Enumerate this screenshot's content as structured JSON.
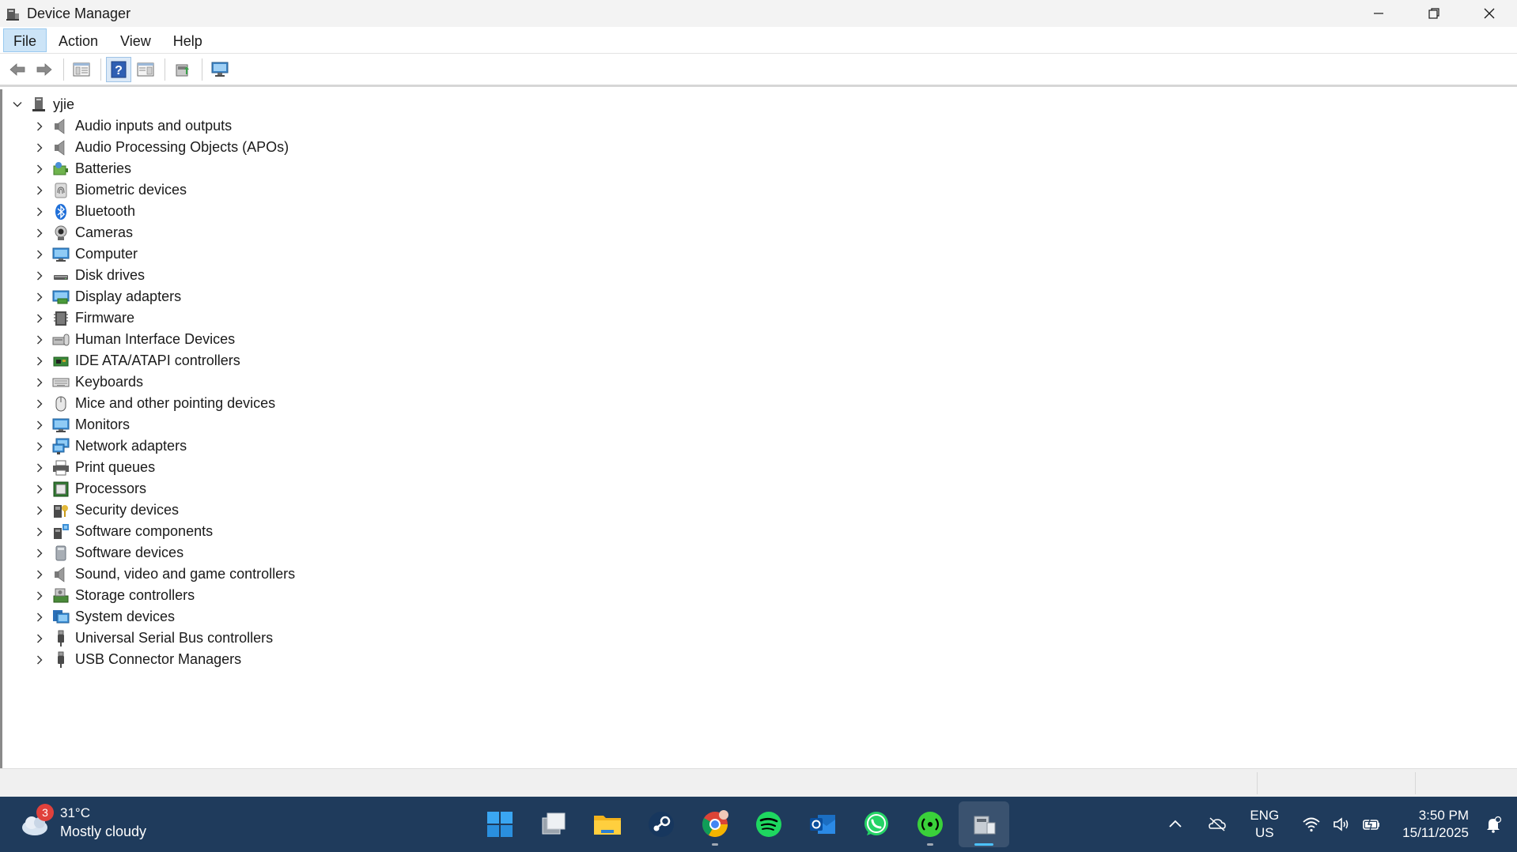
{
  "window": {
    "title": "Device Manager",
    "icon": "device-manager-icon",
    "controls": [
      "minimize-icon",
      "restore-icon",
      "close-icon"
    ]
  },
  "menu": {
    "items": [
      "File",
      "Action",
      "View",
      "Help"
    ],
    "active": "File"
  },
  "toolbar": {
    "buttons": [
      "back-arrow-icon",
      "forward-arrow-icon",
      "show-hide-console-tree-icon",
      "help-icon",
      "properties-pane-icon",
      "update-driver-icon",
      "scan-hardware-icon"
    ],
    "pressed": "help-icon"
  },
  "tree": {
    "root": {
      "label": "yjie",
      "expanded": true,
      "icon": "computer-tower-icon"
    },
    "items": [
      {
        "label": "Audio inputs and outputs",
        "icon": "speaker-icon"
      },
      {
        "label": "Audio Processing Objects (APOs)",
        "icon": "speaker-icon"
      },
      {
        "label": "Batteries",
        "icon": "battery-icon"
      },
      {
        "label": "Biometric devices",
        "icon": "fingerprint-icon"
      },
      {
        "label": "Bluetooth",
        "icon": "bluetooth-icon"
      },
      {
        "label": "Cameras",
        "icon": "camera-icon"
      },
      {
        "label": "Computer",
        "icon": "monitor-icon"
      },
      {
        "label": "Disk drives",
        "icon": "disk-drive-icon"
      },
      {
        "label": "Display adapters",
        "icon": "display-adapter-icon"
      },
      {
        "label": "Firmware",
        "icon": "firmware-icon"
      },
      {
        "label": "Human Interface Devices",
        "icon": "hid-icon"
      },
      {
        "label": "IDE ATA/ATAPI controllers",
        "icon": "ide-controller-icon"
      },
      {
        "label": "Keyboards",
        "icon": "keyboard-icon"
      },
      {
        "label": "Mice and other pointing devices",
        "icon": "mouse-icon"
      },
      {
        "label": "Monitors",
        "icon": "monitor-icon"
      },
      {
        "label": "Network adapters",
        "icon": "network-adapter-icon"
      },
      {
        "label": "Print queues",
        "icon": "printer-icon"
      },
      {
        "label": "Processors",
        "icon": "processor-icon"
      },
      {
        "label": "Security devices",
        "icon": "security-device-icon"
      },
      {
        "label": "Software components",
        "icon": "software-component-icon"
      },
      {
        "label": "Software devices",
        "icon": "software-device-icon"
      },
      {
        "label": "Sound, video and game controllers",
        "icon": "speaker-icon"
      },
      {
        "label": "Storage controllers",
        "icon": "storage-controller-icon"
      },
      {
        "label": "System devices",
        "icon": "system-device-icon"
      },
      {
        "label": "Universal Serial Bus controllers",
        "icon": "usb-icon"
      },
      {
        "label": "USB Connector Managers",
        "icon": "usb-icon"
      }
    ]
  },
  "taskbar": {
    "weather": {
      "badge": "3",
      "temp": "31°C",
      "desc": "Mostly cloudy",
      "icon": "cloud-icon"
    },
    "apps": [
      {
        "name": "start",
        "icon": "windows-start-icon"
      },
      {
        "name": "task-view",
        "icon": "task-view-icon"
      },
      {
        "name": "file-explorer",
        "icon": "folder-icon"
      },
      {
        "name": "steam",
        "icon": "steam-icon"
      },
      {
        "name": "chrome",
        "icon": "chrome-icon",
        "running": true
      },
      {
        "name": "spotify",
        "icon": "spotify-icon"
      },
      {
        "name": "outlook",
        "icon": "outlook-icon"
      },
      {
        "name": "whatsapp",
        "icon": "whatsapp-icon"
      },
      {
        "name": "broadcast",
        "icon": "broadcast-icon",
        "running": true
      },
      {
        "name": "device-manager",
        "icon": "device-manager-icon",
        "active": true
      }
    ],
    "tray": {
      "icons": [
        "chevron-up-icon",
        "onedrive-off-icon"
      ],
      "lang_top": "ENG",
      "lang_bottom": "US",
      "status_icons": [
        "wifi-icon",
        "volume-icon",
        "battery-icon"
      ],
      "time": "3:50 PM",
      "date": "15/11/2025",
      "notification_icon": "notification-icon"
    }
  },
  "colors": {
    "taskbar_bg": "#1f3b5c",
    "menu_active_bg": "#cce4f7",
    "accent": "#4cc2ff"
  }
}
